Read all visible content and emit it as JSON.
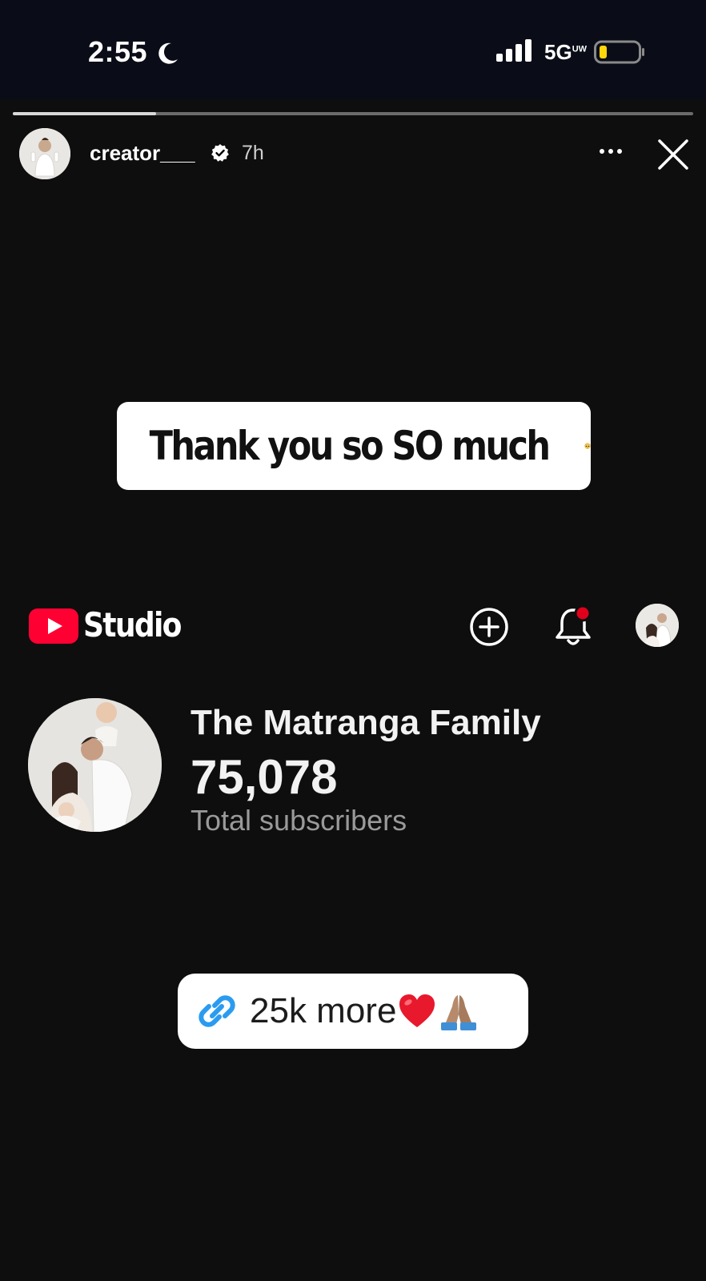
{
  "status_bar": {
    "time": "2:55",
    "network": "5G",
    "network_superscript": "UW",
    "battery_color": "#ffd60a"
  },
  "story": {
    "username": "creator___",
    "age": "7h",
    "progress_fraction": 0.21,
    "sticker_text": "Thank you so SO much",
    "link_sticker_text": "25k more"
  },
  "yt_studio": {
    "brand_label": "Studio",
    "channel_name": "The Matranga Family",
    "subscriber_count": "75,078",
    "subscriber_label": "Total subscribers",
    "brand_color": "#ff0033",
    "notification_dot_color": "#e0001b"
  },
  "icons": [
    "moon-icon",
    "signal-icon",
    "battery-icon",
    "verified-icon",
    "more-icon",
    "close-icon",
    "youtube-logo-icon",
    "create-icon",
    "bell-icon",
    "link-icon",
    "pleading-face-emoji",
    "red-heart-emoji",
    "folded-hands-emoji"
  ]
}
